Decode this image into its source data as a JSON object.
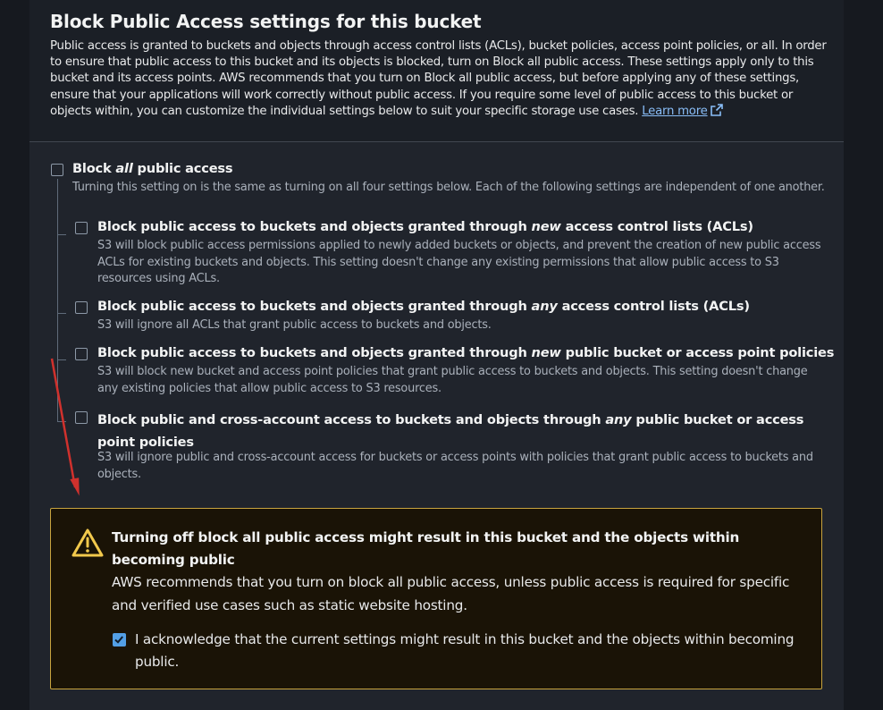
{
  "header": {
    "title": "Block Public Access settings for this bucket",
    "description": "Public access is granted to buckets and objects through access control lists (ACLs), bucket policies, access point policies, or all. In order to ensure that public access to this bucket and its objects is blocked, turn on Block all public access. These settings apply only to this bucket and its access points. AWS recommends that you turn on Block all public access, but before applying any of these settings, ensure that your applications will work correctly without public access. If you require some level of public access to this bucket or objects within, you can customize the individual settings below to suit your specific storage use cases.",
    "learn_more": "Learn more"
  },
  "block_all": {
    "label_pre": "Block ",
    "label_em": "all",
    "label_post": " public access",
    "description": "Turning this setting on is the same as turning on all four settings below. Each of the following settings are independent of one another.",
    "checked": false
  },
  "options": [
    {
      "label_pre": "Block public access to buckets and objects granted through ",
      "label_em": "new",
      "label_post": " access control lists (ACLs)",
      "description": "S3 will block public access permissions applied to newly added buckets or objects, and prevent the creation of new public access ACLs for existing buckets and objects. This setting doesn't change any existing permissions that allow public access to S3 resources using ACLs.",
      "checked": false
    },
    {
      "label_pre": "Block public access to buckets and objects granted through ",
      "label_em": "any",
      "label_post": " access control lists (ACLs)",
      "description": "S3 will ignore all ACLs that grant public access to buckets and objects.",
      "checked": false
    },
    {
      "label_pre": "Block public access to buckets and objects granted through ",
      "label_em": "new",
      "label_post": " public bucket or access point policies",
      "description": "S3 will block new bucket and access point policies that grant public access to buckets and objects. This setting doesn't change any existing policies that allow public access to S3 resources.",
      "checked": false
    },
    {
      "label_pre": "Block public and cross-account access to buckets and objects through ",
      "label_em": "any",
      "label_post": " public bucket or access point policies",
      "description": "S3 will ignore public and cross-account access for buckets or access points with policies that grant public access to buckets and objects.",
      "checked": false
    }
  ],
  "warning": {
    "icon": "warning-triangle-icon",
    "title": "Turning off block all public access might result in this bucket and the objects within becoming public",
    "body": "AWS recommends that you turn on block all public access, unless public access is required for specific and verified use cases such as static website hosting.",
    "ack_label": "I acknowledge that the current settings might result in this bucket and the objects within becoming public.",
    "ack_checked": true
  },
  "colors": {
    "accent": "#539fe5",
    "link": "#89bdf7",
    "warning_border": "#c8a43e",
    "warning_icon": "#f2c94c",
    "annotation_arrow": "#d0312d"
  }
}
